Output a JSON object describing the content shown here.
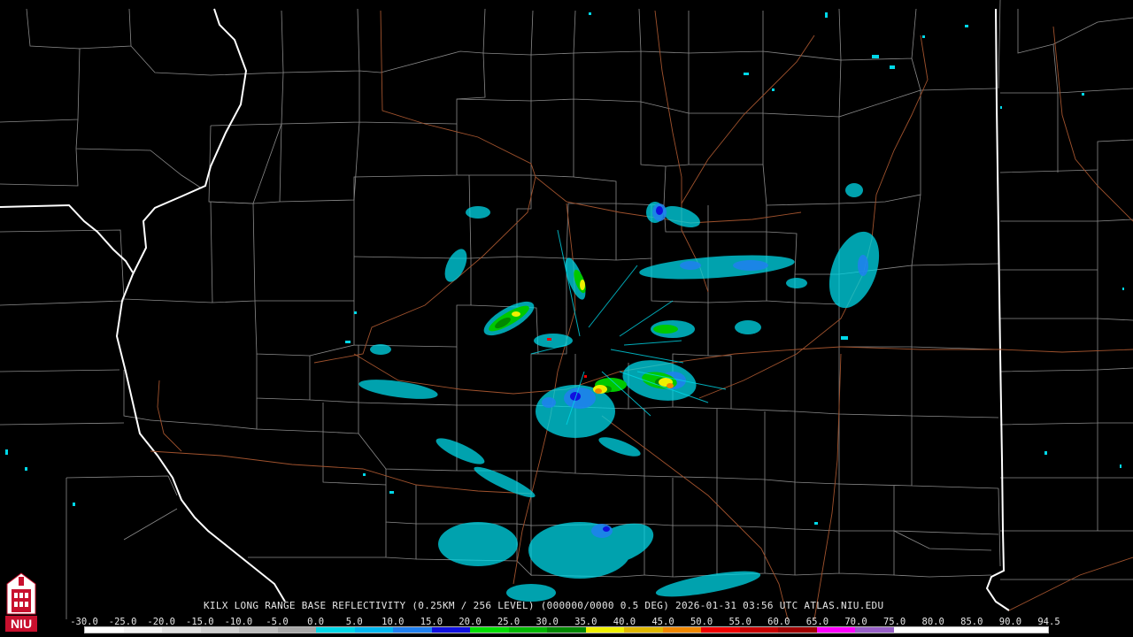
{
  "product": {
    "caption": "KILX LONG RANGE BASE REFLECTIVITY (0.25KM / 256 LEVEL) (000000/0000 0.5 DEG) 2026-01-31 03:56 UTC  ATLAS.NIU.EDU"
  },
  "color_scale": {
    "labels": [
      "-30.0",
      "-25.0",
      "-20.0",
      "-15.0",
      "-10.0",
      "-5.0",
      "0.0",
      "5.0",
      "10.0",
      "15.0",
      "20.0",
      "25.0",
      "30.0",
      "35.0",
      "40.0",
      "45.0",
      "50.0",
      "55.0",
      "60.0",
      "65.0",
      "70.0",
      "75.0",
      "80.0",
      "85.0",
      "90.0",
      "94.5"
    ],
    "colors": [
      "#ffffff",
      "#f2f2f2",
      "#e0e0e0",
      "#cfcfcf",
      "#bdbdbd",
      "#a8a8a8",
      "#00d8e8",
      "#00b8f0",
      "#2080f0",
      "#1010e0",
      "#00e000",
      "#00b800",
      "#008800",
      "#f0f000",
      "#e0b800",
      "#f08800",
      "#f00000",
      "#c80000",
      "#a00000",
      "#ff00ff",
      "#9860c8",
      "#ffffff",
      "#ffffff",
      "#ffffff",
      "#ffffff"
    ]
  },
  "logo": {
    "text": "NIU",
    "colors": {
      "primary": "#c8102e",
      "secondary": "#ffffff"
    }
  },
  "map_colors": {
    "background": "#000000",
    "county_border": "#8a8a8a",
    "state_border": "#ffffff",
    "highway": "#a0522d"
  }
}
